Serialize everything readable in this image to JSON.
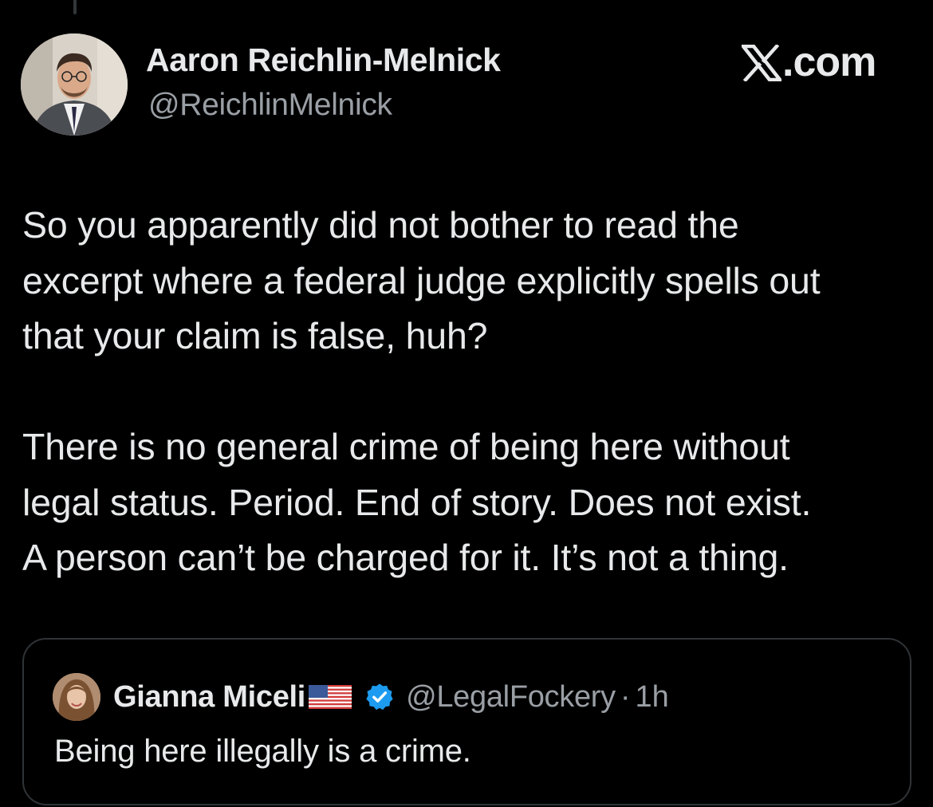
{
  "author": {
    "name": "Aaron Reichlin-Melnick",
    "handle": "@ReichlinMelnick"
  },
  "source_label": ".com",
  "tweet": {
    "paragraphs": [
      [
        "So you apparently did not bother to read the",
        "excerpt where a federal judge explicitly spells out",
        "that your claim is false, huh?"
      ],
      [
        "There is no general crime of being here without",
        "legal status. Period. End of story. Does not exist.",
        "A person can’t be charged for it. It’s not a thing."
      ]
    ]
  },
  "quoted_tweet": {
    "name": "Gianna Miceli",
    "handle": "@LegalFockery",
    "separator": "·",
    "time": "1h",
    "text": "Being here illegally is a crime."
  },
  "colors": {
    "background": "#000000",
    "primary_text": "#e7e9ea",
    "secondary_text": "#9a9fa5",
    "border": "#2f3336",
    "verified": "#1d9bf0"
  },
  "icons": [
    "x-logo-icon",
    "us-flag-icon",
    "verified-badge-icon"
  ]
}
